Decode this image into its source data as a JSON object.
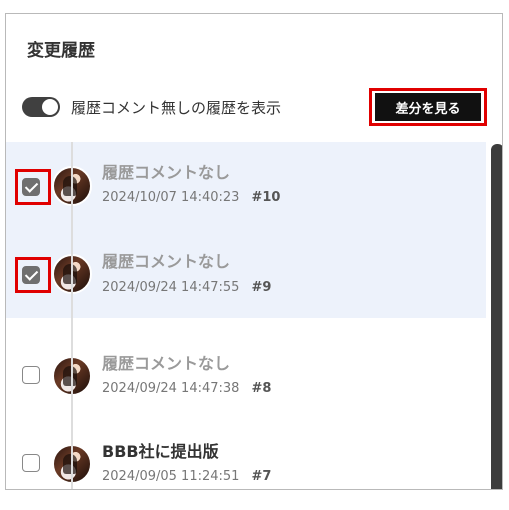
{
  "panel": {
    "title": "変更履歴",
    "toggle_label": "履歴コメント無しの履歴を表示",
    "diff_button": "差分を見る"
  },
  "history": [
    {
      "title": "履歴コメントなし",
      "date": "2024/10/07 14:40:23",
      "rev": "#10",
      "checked": true,
      "style": "muted"
    },
    {
      "title": "履歴コメントなし",
      "date": "2024/09/24 14:47:55",
      "rev": "#9",
      "checked": true,
      "style": "muted"
    },
    {
      "title": "履歴コメントなし",
      "date": "2024/09/24 14:47:38",
      "rev": "#8",
      "checked": false,
      "style": "muted"
    },
    {
      "title": "BBB社に提出版",
      "date": "2024/09/05 11:24:51",
      "rev": "#7",
      "checked": false,
      "style": "bold"
    }
  ],
  "colors": {
    "highlight_red": "#e00000",
    "selected_row_bg": "#edf2fb",
    "button_black": "#111111"
  }
}
